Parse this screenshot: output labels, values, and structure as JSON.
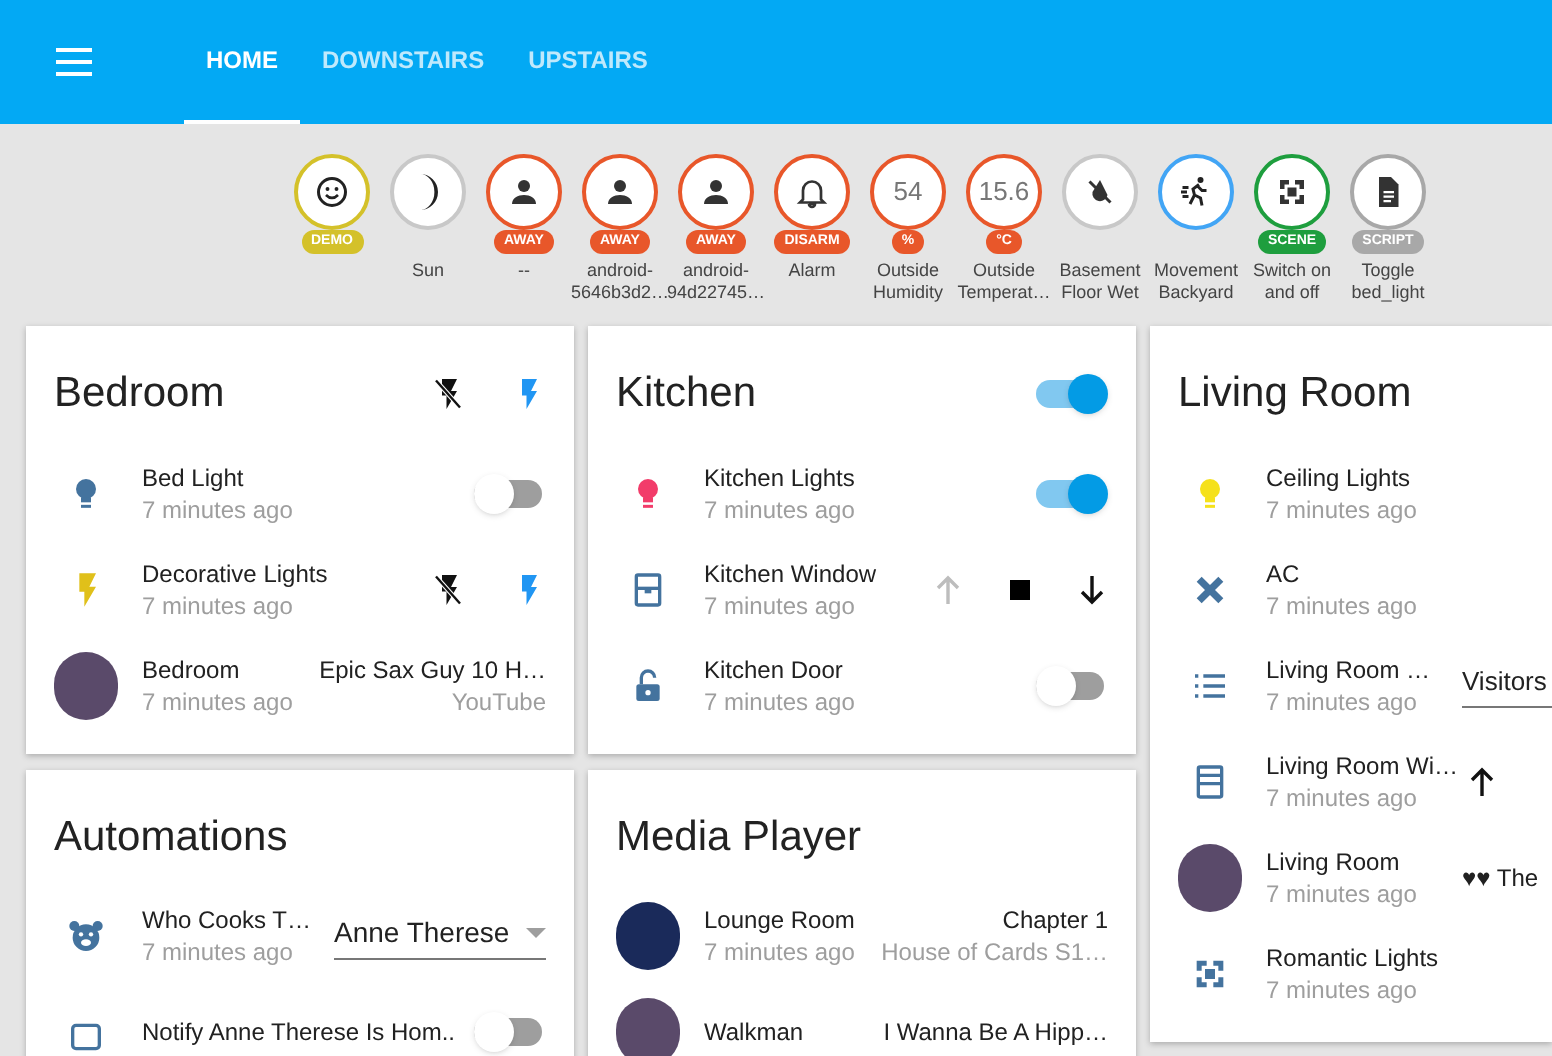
{
  "toolbar": {
    "tabs": [
      {
        "label": "HOME",
        "selected": true
      },
      {
        "label": "DOWNSTAIRS",
        "selected": false
      },
      {
        "label": "UPSTAIRS",
        "selected": false
      }
    ]
  },
  "badges": [
    {
      "kind": "icon",
      "tag": "DEMO",
      "color": "#d4c12a"
    },
    {
      "kind": "icon",
      "color": "#c8c8c8",
      "label": "Sun"
    },
    {
      "kind": "icon",
      "tag": "AWAY",
      "color": "#e8572a",
      "label": "--"
    },
    {
      "kind": "icon",
      "tag": "AWAY",
      "color": "#e8572a",
      "label": "android-5646b3d2…"
    },
    {
      "kind": "icon",
      "tag": "AWAY",
      "color": "#e8572a",
      "label": "android-94d22745…"
    },
    {
      "kind": "icon",
      "tag": "DISARM",
      "color": "#e8572a",
      "label": "Alarm"
    },
    {
      "kind": "value",
      "value": "54",
      "tag": "%",
      "color": "#e8572a",
      "label": "Outside Humidity"
    },
    {
      "kind": "value",
      "value": "15.6",
      "tag": "°C",
      "color": "#e8572a",
      "label": "Outside Temperat…"
    },
    {
      "kind": "icon",
      "color": "#c8c8c8",
      "label": "Basement Floor Wet"
    },
    {
      "kind": "icon",
      "color": "#42a5f5",
      "label": "Movement Backyard"
    },
    {
      "kind": "icon",
      "tag": "SCENE",
      "color": "#1e9e3e",
      "label": "Switch on and off"
    },
    {
      "kind": "icon",
      "tag": "SCRIPT",
      "color": "#a8a8a8",
      "label": "Toggle bed_light"
    }
  ],
  "columns": [
    [
      {
        "title": "Bedroom",
        "header": {
          "kind": "buttons"
        },
        "entities": [
          {
            "name": "Bed Light",
            "time": "7 minutes ago",
            "kind": "switch",
            "on": false
          },
          {
            "name": "Decorative Lights",
            "time": "7 minutes ago",
            "kind": "buttons"
          },
          {
            "name": "Bedroom",
            "time": "7 minutes ago",
            "kind": "media",
            "title": "Epic Sax Guy 10 H…",
            "subtitle": "YouTube"
          }
        ]
      },
      {
        "title": "Automations",
        "entities": [
          {
            "name": "Who Cooks T…",
            "time": "7 minutes ago",
            "kind": "select",
            "value": "Anne Therese"
          },
          {
            "name": "Notify Anne Therese Is Hom..",
            "kind": "switch",
            "on": false
          }
        ]
      }
    ],
    [
      {
        "title": "Kitchen",
        "header": {
          "kind": "switch",
          "on": true
        },
        "entities": [
          {
            "name": "Kitchen Lights",
            "time": "7 minutes ago",
            "kind": "switch",
            "on": true
          },
          {
            "name": "Kitchen Window",
            "time": "7 minutes ago",
            "kind": "cover",
            "up_disabled": true
          },
          {
            "name": "Kitchen Door",
            "time": "7 minutes ago",
            "kind": "switch",
            "on": false
          }
        ]
      },
      {
        "title": "Media Player",
        "entities": [
          {
            "name": "Lounge Room",
            "time": "7 minutes ago",
            "kind": "media",
            "title": "Chapter 1",
            "subtitle": "House of Cards S1…"
          },
          {
            "name": "Walkman",
            "kind": "media",
            "title": "I Wanna Be A Hipp…"
          }
        ]
      }
    ],
    [
      {
        "title": "Living Room",
        "entities": [
          {
            "name": "Ceiling Lights",
            "time": "7 minutes ago",
            "kind": "none"
          },
          {
            "name": "AC",
            "time": "7 minutes ago",
            "kind": "none"
          },
          {
            "name": "Living Room …",
            "time": "7 minutes ago",
            "kind": "select",
            "value": "Visitors"
          },
          {
            "name": "Living Room Wi…",
            "time": "7 minutes ago",
            "kind": "cover",
            "up_disabled": false
          },
          {
            "name": "Living Room",
            "time": "7 minutes ago",
            "kind": "media",
            "title": "♥♥ The"
          },
          {
            "name": "Romantic Lights",
            "time": "7 minutes ago",
            "kind": "none"
          }
        ]
      }
    ]
  ]
}
